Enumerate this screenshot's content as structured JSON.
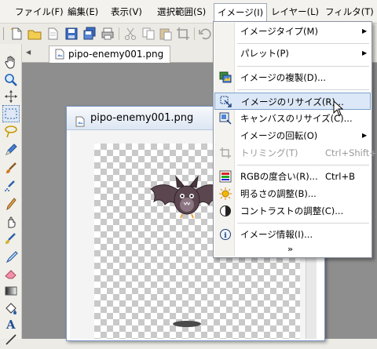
{
  "menubar": {
    "items": [
      {
        "label": "ファイル(F)"
      },
      {
        "label": "編集(E)"
      },
      {
        "label": "表示(V)"
      },
      {
        "label": "選択範囲(S)"
      },
      {
        "label": "イメージ(I)"
      },
      {
        "label": "レイヤー(L)"
      },
      {
        "label": "フィルタ(T)"
      }
    ]
  },
  "tab": {
    "label": "pipo-enemy001.png"
  },
  "document": {
    "title": "pipo-enemy001.png"
  },
  "image_menu": {
    "items": [
      {
        "label": "イメージタイプ(M)",
        "submenu": true
      },
      {
        "label": "パレット(P)",
        "submenu": true
      },
      {
        "label": "イメージの複製(D)..."
      },
      {
        "label": "イメージのリサイズ(R)...",
        "highlighted": true
      },
      {
        "label": "キャンバスのリサイズ(C)..."
      },
      {
        "label": "イメージの回転(O)",
        "submenu": true
      },
      {
        "label": "トリミング(T)",
        "shortcut": "Ctrl+Shift+T",
        "disabled": true
      },
      {
        "label": "RGBの度合い(R)...",
        "shortcut": "Ctrl+B"
      },
      {
        "label": "明るさの調整(B)..."
      },
      {
        "label": "コントラストの調整(C)..."
      },
      {
        "label": "イメージ情報(I)..."
      }
    ],
    "more_icon": "double-chevron-down-icon"
  },
  "colors": {
    "highlight": "#dce8f7",
    "menu_border": "#8d95a2",
    "bat_body": "#5b4650"
  }
}
